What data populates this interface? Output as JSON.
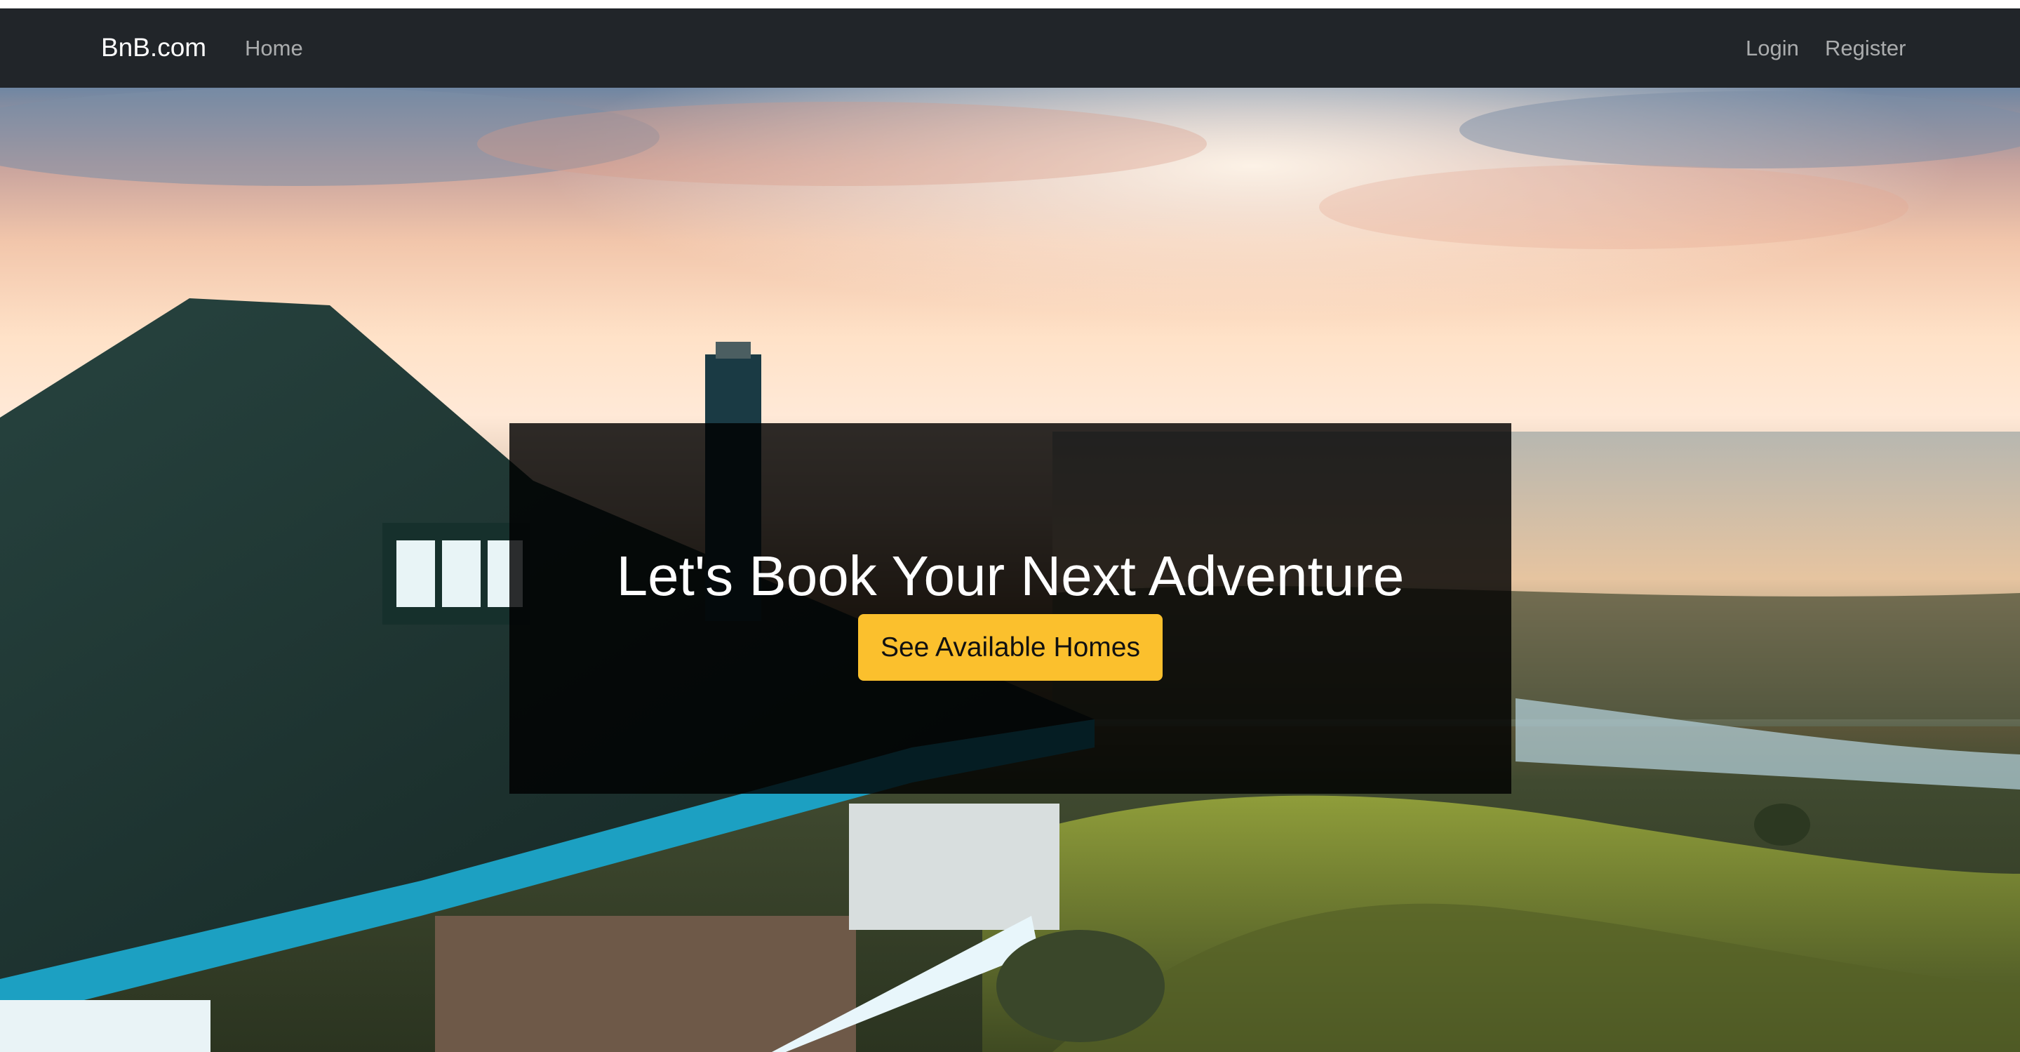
{
  "navbar": {
    "brand": "BnB.com",
    "links": [
      {
        "label": "Home"
      },
      {
        "label": "Login"
      },
      {
        "label": "Register"
      }
    ]
  },
  "hero": {
    "headline": "Let's Book Your Next Adventure",
    "cta_label": "See Available Homes",
    "accent_color": "#fbc02d",
    "nav_background": "#212529"
  }
}
